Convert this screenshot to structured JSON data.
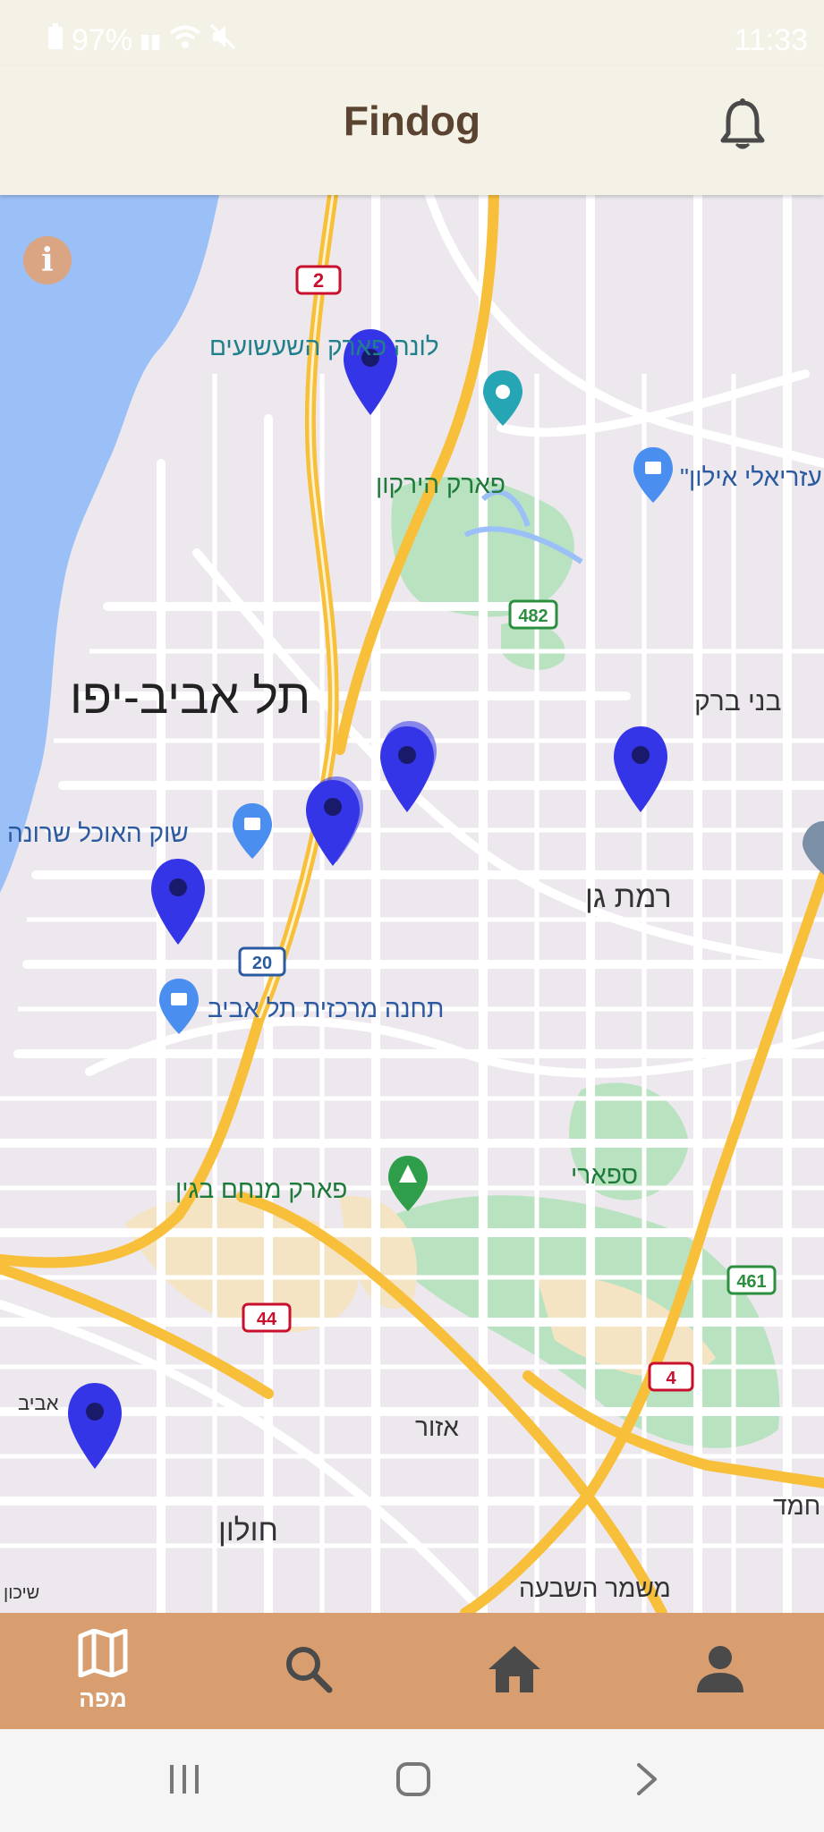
{
  "status_bar": {
    "battery": "97%",
    "time": "11:33"
  },
  "header": {
    "title": "Findog"
  },
  "map": {
    "labels": {
      "tel_aviv": "תל אביב-יפו",
      "luna_park": "לונה פארק השעשועים",
      "park_hayarkon": "פארק הירקון",
      "ayalon_mall": "עזריאלי אילון\"",
      "bnei_brak": "בני ברק",
      "ramat_gan": "רמת גן",
      "shuk": "שוק האוכל שרונה",
      "central_station": "תחנה מרכזית תל אביב",
      "begin_park": "פארק מנחם בגין",
      "safari": "ספארי",
      "holon": "חולון",
      "azor": "אזור",
      "mishmar": "משמר השבעה",
      "hemed": "חמד",
      "aviv_edge": "אביב",
      "shikun": "שיכון"
    },
    "road_shields": {
      "r2": "2",
      "r482": "482",
      "r20": "20",
      "r44": "44",
      "r4": "4",
      "r461": "461"
    },
    "info_button": "i",
    "colors": {
      "marker": "#3535e8",
      "marker_dot": "#1a1a6b",
      "water": "#9bbff7",
      "road": "#ffffff",
      "highway": "#f7bf3a",
      "park": "#b9e3c0",
      "land": "#ece8ee"
    }
  },
  "bottom_nav": {
    "items": [
      {
        "icon": "map-icon",
        "label": "מפה",
        "active": true
      },
      {
        "icon": "search-icon",
        "label": ""
      },
      {
        "icon": "home-icon",
        "label": ""
      },
      {
        "icon": "profile-icon",
        "label": ""
      }
    ],
    "background": "#d89e70"
  }
}
